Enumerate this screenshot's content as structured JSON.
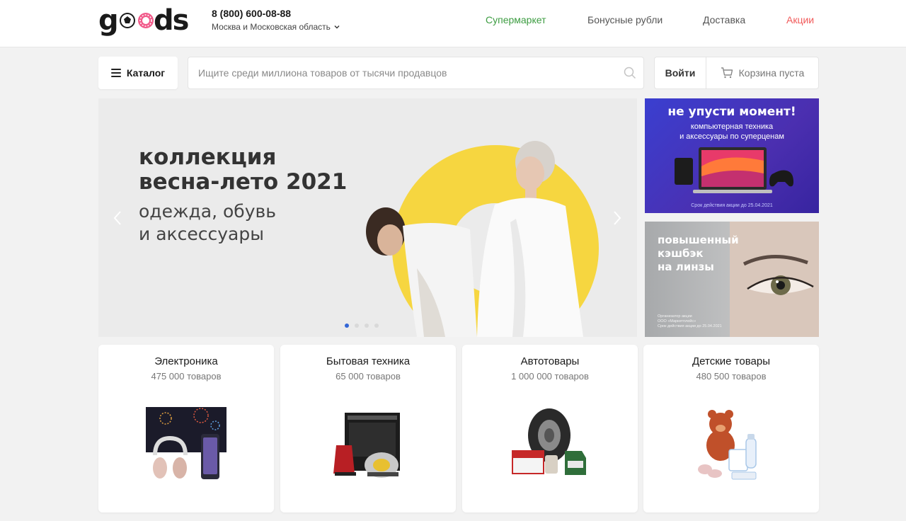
{
  "header": {
    "logo_text": "goods",
    "phone": "8 (800) 600-08-88",
    "region": "Москва и Московская область",
    "nav": {
      "supermarket": "Супермаркет",
      "bonus": "Бонусные рубли",
      "delivery": "Доставка",
      "promo": "Акции"
    }
  },
  "toolbar": {
    "catalog_label": "Каталог",
    "search_placeholder": "Ищите среди миллиона товаров от тысячи продавцов",
    "login_label": "Войти",
    "cart_label": "Корзина пуста"
  },
  "banner": {
    "title_line1": "коллекция",
    "title_line2": "весна-лето 2021",
    "sub_line1": "одежда, обувь",
    "sub_line2": "и аксессуары"
  },
  "promo_computers": {
    "title": "не упусти момент!",
    "sub_line1": "компьютерная техника",
    "sub_line2": "и аксессуары по суперценам",
    "note": "Срок действия акции до 25.04.2021"
  },
  "promo_lenses": {
    "title_line1": "повышенный",
    "title_line2": "кэшбэк",
    "title_line3": "на линзы",
    "note_line1": "Организатор акции",
    "note_line2": "ООО «Маркетплейс»",
    "note_line3": "Срок действия акции до 25.04.2021"
  },
  "categories": [
    {
      "title": "Электроника",
      "count": "475 000 товаров"
    },
    {
      "title": "Бытовая техника",
      "count": "65 000 товаров"
    },
    {
      "title": "Автотовары",
      "count": "1 000 000 товаров"
    },
    {
      "title": "Детские товары",
      "count": "480 500 товаров"
    }
  ],
  "colors": {
    "supermarket": "#3c9c41",
    "promo": "#f15a5a",
    "banner_accent": "#f6d640",
    "promo_blue": "#3a3fd0",
    "slider_active": "#3366d6"
  }
}
